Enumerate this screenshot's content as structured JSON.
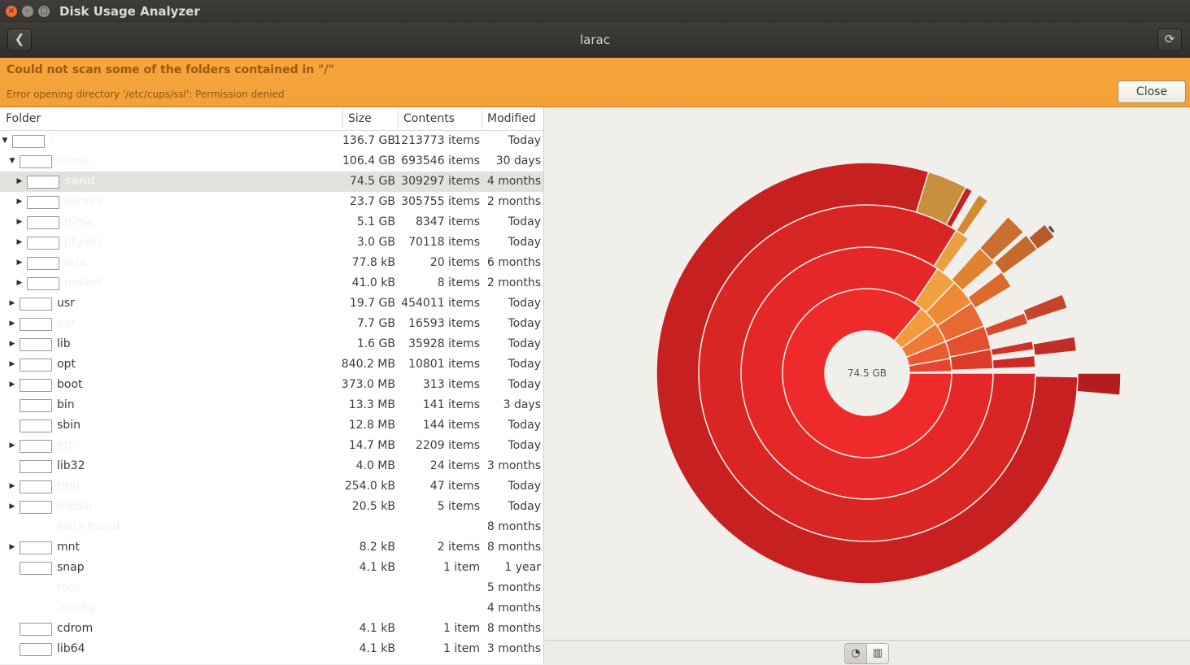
{
  "window": {
    "title": "Disk Usage Analyzer",
    "close_glyph": "×",
    "minimize_glyph": "–",
    "maximize_glyph": "□"
  },
  "header": {
    "location": "larac",
    "back_glyph": "❮",
    "refresh_glyph": "⟳"
  },
  "infobar": {
    "title": "Could not scan some of the folders contained in \"/\"",
    "detail": "Error opening directory '/etc/cups/ssl': Permission denied",
    "close_label": "Close"
  },
  "tree": {
    "columns": {
      "folder": "Folder",
      "size": "Size",
      "contents": "Contents",
      "modified": "Modified"
    },
    "rows": [
      {
        "name": "/",
        "size": "136.7 GB",
        "contents": "1213773 items",
        "modified": "Today",
        "level": 0,
        "expander": "expanded",
        "dim": true,
        "chip": true
      },
      {
        "name": "home",
        "size": "106.4 GB",
        "contents": "693546 items",
        "modified": "30 days",
        "level": 1,
        "expander": "expanded",
        "dim": true,
        "chip": true
      },
      {
        "name": "sand",
        "size": "74.5 GB",
        "contents": "309297 items",
        "modified": "4 months",
        "level": 2,
        "expander": "collapsed",
        "dim": true,
        "chip": true,
        "selected": true
      },
      {
        "name": "dennis",
        "size": "23.7 GB",
        "contents": "305755 items",
        "modified": "2 months",
        "level": 2,
        "expander": "collapsed",
        "dim": true,
        "chip": true
      },
      {
        "name": "nima",
        "size": "5.1 GB",
        "contents": "8347 items",
        "modified": "Today",
        "level": 2,
        "expander": "collapsed",
        "dim": true,
        "chip": true
      },
      {
        "name": "phj-nh",
        "size": "3.0 GB",
        "contents": "70118 items",
        "modified": "Today",
        "level": 2,
        "expander": "collapsed",
        "dim": true,
        "chip": true
      },
      {
        "name": "lara",
        "size": "77.8 kB",
        "contents": "20 items",
        "modified": "6 months",
        "level": 2,
        "expander": "collapsed",
        "dim": true,
        "chip": true
      },
      {
        "name": "mikkel",
        "size": "41.0 kB",
        "contents": "8 items",
        "modified": "2 months",
        "level": 2,
        "expander": "collapsed",
        "dim": true,
        "chip": true
      },
      {
        "name": "usr",
        "size": "19.7 GB",
        "contents": "454011 items",
        "modified": "Today",
        "level": 1,
        "expander": "collapsed",
        "dim": false,
        "chip": true
      },
      {
        "name": "var",
        "size": "7.7 GB",
        "contents": "16593 items",
        "modified": "Today",
        "level": 1,
        "expander": "collapsed",
        "dim": true,
        "chip": true
      },
      {
        "name": "lib",
        "size": "1.6 GB",
        "contents": "35928 items",
        "modified": "Today",
        "level": 1,
        "expander": "collapsed",
        "dim": false,
        "chip": true
      },
      {
        "name": "opt",
        "size": "840.2 MB",
        "contents": "10801 items",
        "modified": "Today",
        "level": 1,
        "expander": "collapsed",
        "dim": false,
        "chip": true
      },
      {
        "name": "boot",
        "size": "373.0 MB",
        "contents": "313 items",
        "modified": "Today",
        "level": 1,
        "expander": "collapsed",
        "dim": false,
        "chip": true
      },
      {
        "name": "bin",
        "size": "13.3 MB",
        "contents": "141 items",
        "modified": "3 days",
        "level": 1,
        "expander": "none",
        "dim": false,
        "chip": true
      },
      {
        "name": "sbin",
        "size": "12.8 MB",
        "contents": "144 items",
        "modified": "Today",
        "level": 1,
        "expander": "none",
        "dim": false,
        "chip": true
      },
      {
        "name": "etc",
        "size": "14.7 MB",
        "contents": "2209 items",
        "modified": "Today",
        "level": 1,
        "expander": "collapsed",
        "dim": true,
        "chip": true
      },
      {
        "name": "lib32",
        "size": "4.0 MB",
        "contents": "24 items",
        "modified": "3 months",
        "level": 1,
        "expander": "none",
        "dim": false,
        "chip": true
      },
      {
        "name": "tmp",
        "size": "254.0 kB",
        "contents": "47 items",
        "modified": "Today",
        "level": 1,
        "expander": "collapsed",
        "dim": true,
        "chip": true
      },
      {
        "name": "media",
        "size": "20.5 kB",
        "contents": "5 items",
        "modified": "Today",
        "level": 1,
        "expander": "collapsed",
        "dim": true,
        "chip": true
      },
      {
        "name": "lost+found",
        "size": "",
        "contents": "",
        "modified": "8 months",
        "level": 1,
        "expander": "none",
        "dim": true,
        "chip": false
      },
      {
        "name": "mnt",
        "size": "8.2 kB",
        "contents": "2 items",
        "modified": "8 months",
        "level": 1,
        "expander": "collapsed",
        "dim": false,
        "chip": true
      },
      {
        "name": "snap",
        "size": "4.1 kB",
        "contents": "1 item",
        "modified": "1 year",
        "level": 1,
        "expander": "none",
        "dim": false,
        "chip": true
      },
      {
        "name": "root",
        "size": "",
        "contents": "",
        "modified": "5 months",
        "level": 1,
        "expander": "none",
        "dim": true,
        "chip": false
      },
      {
        "name": ".config",
        "size": "",
        "contents": "",
        "modified": "4 months",
        "level": 1,
        "expander": "none",
        "dim": true,
        "chip": false
      },
      {
        "name": "cdrom",
        "size": "4.1 kB",
        "contents": "1 item",
        "modified": "8 months",
        "level": 1,
        "expander": "none",
        "dim": false,
        "chip": true
      },
      {
        "name": "lib64",
        "size": "4.1 kB",
        "contents": "1 item",
        "modified": "3 months",
        "level": 1,
        "expander": "none",
        "dim": false,
        "chip": true
      }
    ]
  },
  "chart": {
    "center_label": "74.5 GB",
    "colors": {
      "ring1": "#ef2a2a",
      "ring2": "#e52727",
      "ring3": "#da2525",
      "ring4": "#c72020",
      "accent_orange": "#f59a3a",
      "accent_tan": "#c98f40"
    }
  },
  "view_switcher": {
    "rings_icon": "rings-chart-icon",
    "treemap_icon": "treemap-chart-icon"
  }
}
